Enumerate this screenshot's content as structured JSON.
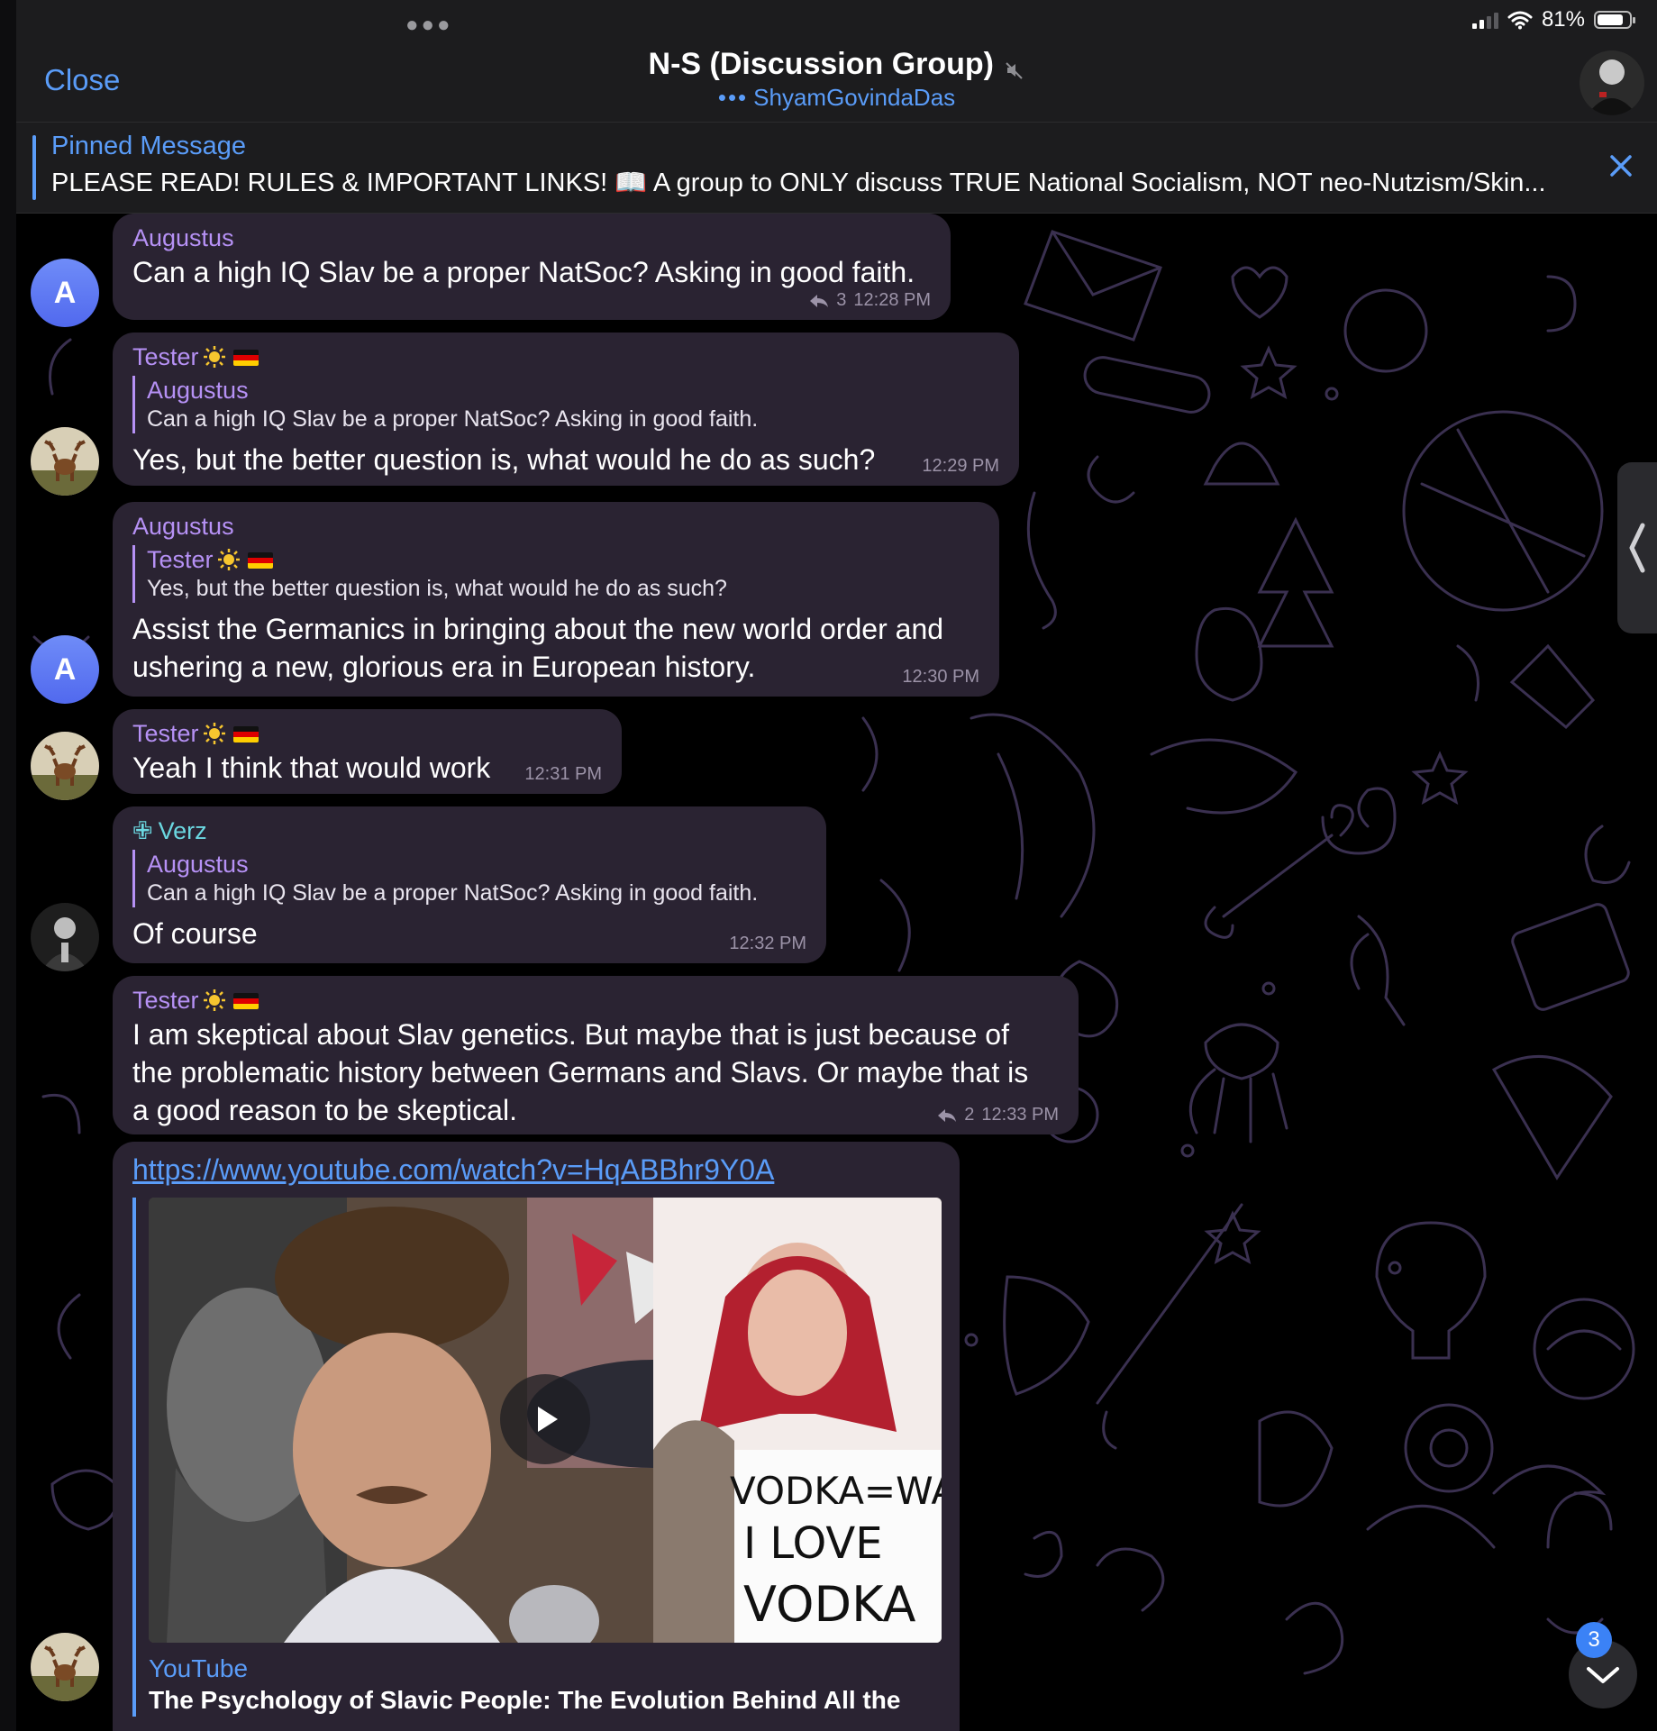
{
  "status_bar": {
    "battery": "81%",
    "battery_level": 0.81
  },
  "header": {
    "close_label": "Close",
    "title": "N-S (Discussion Group)",
    "typing_user": "ShyamGovindaDas"
  },
  "pinned": {
    "label": "Pinned Message",
    "text": "PLEASE READ! RULES & IMPORTANT LINKS! 📖 A group to ONLY discuss TRUE National Socialism, NOT neo-Nutzism/Skin..."
  },
  "messages": [
    {
      "sender": "Augustus",
      "text": "Can a high IQ Slav be a proper NatSoc? Asking in good faith.",
      "replies": "3",
      "time": "12:28 PM"
    },
    {
      "sender": "Tester",
      "quote_name": "Augustus",
      "quote_text": "Can a high IQ Slav be a proper NatSoc? Asking in good faith.",
      "text": "Yes, but the better question is, what would he do as such?",
      "time": "12:29 PM"
    },
    {
      "sender": "Augustus",
      "quote_name": "Tester",
      "quote_text": "Yes, but the better question is, what would he do as such?",
      "text_line1": "Assist the Germanics in bringing about the new world order and",
      "text_line2": "ushering a new, glorious era in European history.",
      "time": "12:30 PM"
    },
    {
      "sender": "Tester",
      "text": "Yeah I think that would work",
      "time": "12:31 PM"
    },
    {
      "sender": "Verz",
      "quote_name": "Augustus",
      "quote_text": "Can a high IQ Slav be a proper NatSoc? Asking in good faith.",
      "text": "Of course",
      "time": "12:32 PM"
    },
    {
      "sender": "Tester",
      "text_line1": "I am skeptical about Slav genetics. But maybe that is just because of",
      "text_line2": "the problematic history between Germans and Slavs. Or maybe that is",
      "text_line3": "a good reason to be skeptical.",
      "replies": "2",
      "time": "12:33 PM"
    },
    {
      "link": "https://www.youtube.com/watch?v=HqABBhr9Y0A",
      "sign_line1": "VODKA=WATER",
      "sign_line2": "I LOVE",
      "sign_line3": "VODKA",
      "site": "YouTube",
      "preview_title": "The Psychology of Slavic People: The Evolution Behind All the"
    }
  ],
  "avatars": {
    "augustus_letter": "A"
  },
  "scroll": {
    "unread_count": "3"
  },
  "colors": {
    "accent": "#5a9cf8",
    "bubble": "#2a2332",
    "sender_name": "#b691f5",
    "verz_name": "#6bd7e0"
  }
}
